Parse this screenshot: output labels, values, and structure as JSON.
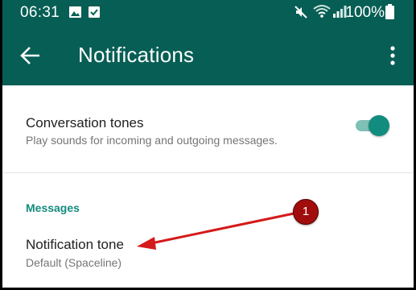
{
  "status_bar": {
    "time": "06:31",
    "battery": "100%",
    "left_icons": [
      "image-icon",
      "checkbox-icon"
    ],
    "right_icons": [
      "mute-icon",
      "wifi-icon",
      "signal-icon",
      "battery-icon"
    ]
  },
  "app_bar": {
    "title": "Notifications",
    "back_icon": "arrow-left-icon",
    "menu_icon": "more-vert-icon"
  },
  "settings": {
    "conversation_tones": {
      "title": "Conversation tones",
      "subtitle": "Play sounds for incoming and outgoing messages.",
      "enabled": true
    },
    "messages_section": {
      "header": "Messages",
      "notification_tone": {
        "title": "Notification tone",
        "value": "Default (Spaceline)"
      }
    }
  },
  "annotation": {
    "callout_number": "1",
    "arrow_color": "#d41a1a"
  },
  "colors": {
    "primary": "#075e54",
    "accent": "#128c7e",
    "toggle_track": "#7fc0b6"
  }
}
